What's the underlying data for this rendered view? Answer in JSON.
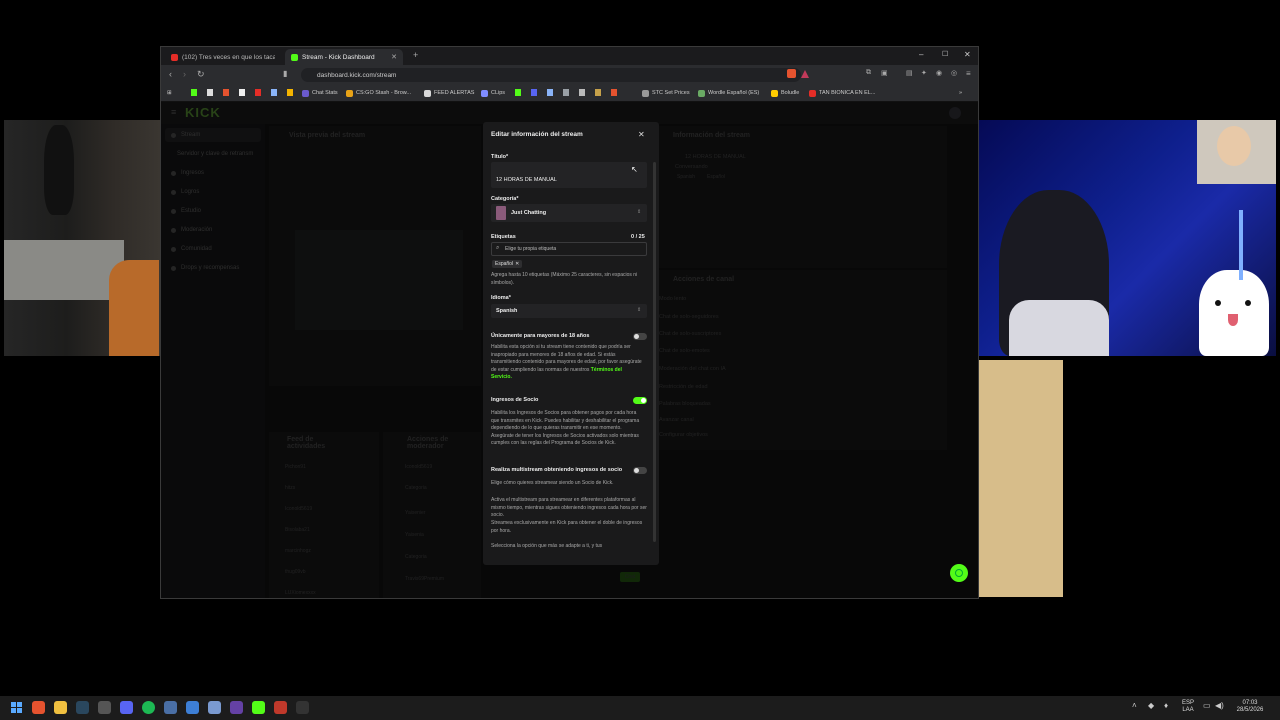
{
  "browser": {
    "tabs": [
      {
        "title": "(102) Tres veces en que los tacaños s",
        "favicon_color": "#e52d27",
        "active": false
      },
      {
        "title": "Stream - Kick Dashboard",
        "favicon_color": "#53fc18",
        "active": true
      }
    ],
    "url": "dashboard.kick.com/stream",
    "bookmarks": [
      {
        "label": "Chat Stats",
        "icon_color": "#6a5acd"
      },
      {
        "label": "CS:GO Stash - Brow...",
        "icon_color": "#e8a317"
      },
      {
        "label": "FEED ALERTAS",
        "icon_color": "#d8d8d8"
      },
      {
        "label": "CLips",
        "icon_color": "#7f8cff"
      },
      {
        "label": "STC Set Prices",
        "icon_color": "#999"
      },
      {
        "label": "Wordle Español (ES)",
        "icon_color": "#6aaa64"
      },
      {
        "label": "Boludle",
        "icon_color": "#ffcc00"
      },
      {
        "label": "TAN BIONICA EN EL...",
        "icon_color": "#e52d27"
      }
    ]
  },
  "kick": {
    "logo": "KICK",
    "sidebar": {
      "items": [
        "Stream",
        "Servidor y clave de retransm",
        "Ingresos",
        "Logros",
        "Estudio",
        "Moderación",
        "Comunidad",
        "Drops y recompensas"
      ]
    },
    "preview_title": "Vista previa del stream",
    "info_title": "Información del stream",
    "info_stream_title": "12 HORAS DE MANUAL",
    "info_category": "Conversando",
    "info_tags": [
      "Spanish",
      "Español"
    ],
    "channel_actions_title": "Acciones de canal",
    "channel_actions": [
      "Modo lento",
      "Chat de solo-seguidores",
      "Chat de solo-suscriptores",
      "Chat de solo-emotes",
      "Moderación del chat con IA",
      "Restricción de edad",
      "Palabras bloqueadas",
      "Avanzar canal",
      "Configurar objetivos"
    ],
    "feed_title": "Feed de actividades",
    "feed_items": [
      "Pichon91",
      "hitzs",
      "Iconold5619",
      "Bisolaba21",
      "marcinhogz",
      "thug09vb",
      "LUXiomexxxx"
    ],
    "mod_title": "Acciones de moderador",
    "mod_items": [
      "Iconold5619",
      "Categoria",
      "Yaisenier",
      "Yaisenia",
      "Categoria",
      "Travis69Premium"
    ],
    "chat_button": "Chat"
  },
  "modal": {
    "title": "Editar información del stream",
    "title_label": "Título*",
    "title_value": "12 HORAS DE MANUAL",
    "category_label": "Categoría*",
    "category_value": "Just Chatting",
    "tags_label": "Etiquetas",
    "tags_count": "0 / 25",
    "tags_placeholder": "Elige tu propia etiqueta",
    "tag_chip": "Español",
    "tags_help": "Agrega hasta 10 etiquetas (Máximo 25 caracteres, sin espacios ni símbolos).",
    "language_label": "Idioma*",
    "language_value": "Spanish",
    "adult_label": "Únicamente para mayores de 18 años",
    "adult_toggle_on": false,
    "adult_help": "Habilita esta opción si tu stream tiene contenido que podría ser inapropiado para menores de 18 años de edad. Si estás transmitiendo contenido para mayores de edad, por favor asegúrate de estar cumpliendo las normas de nuestros",
    "adult_link": "Términos del Servicio.",
    "partner_label": "Ingresos de Socio",
    "partner_toggle_on": true,
    "partner_help": "Habilita los Ingresos de Socios para obtener pagos por cada hora que transmites en Kick. Puedes habilitar y deshabilitar el programa dependiendo de lo que quieras transmitir en ese momento. Asegúrate de tener los Ingresos de Socios activados solo mientras cumples con las reglas del Programa de Socios de Kick.",
    "multistream_label": "Realiza multistream obteniendo ingresos de socio",
    "multistream_toggle_on": false,
    "multistream_sub": "Elige cómo quieres streamear siendo un Socio de Kick.",
    "multistream_help_1": "Activa el multistream para streamear en diferentes plataformas al mismo tiempo, mientras sigues obteniendo ingresos cada hora por ser socio.",
    "multistream_help_2": "Streamea exclusivamente en Kick para obtener el doble de ingresos por hora.",
    "multistream_help_3": "Selecciona la opción que más se adapte a ti, y tus"
  },
  "taskbar": {
    "lang_top": "ESP",
    "lang_bottom": "LAA",
    "time": "07:03",
    "date": "28/5/2026"
  }
}
